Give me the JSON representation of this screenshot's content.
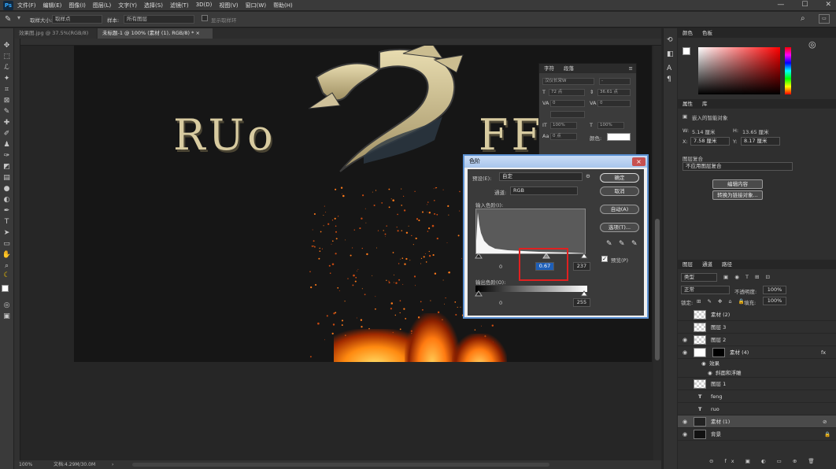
{
  "menu": {
    "items": [
      "文件(F)",
      "编辑(E)",
      "图像(I)",
      "图层(L)",
      "文字(Y)",
      "选择(S)",
      "滤镜(T)",
      "3D(D)",
      "视图(V)",
      "窗口(W)",
      "帮助(H)"
    ]
  },
  "options": {
    "size_label": "取样大小:",
    "size_value": "取样点",
    "sample_label": "样本:",
    "sample_value": "所有图层",
    "show_ring": "显示取样环"
  },
  "tabs": [
    {
      "label": "效果图.jpg @ 37.5%(RGB/8)",
      "close": "×"
    },
    {
      "label": "未标题-1 @ 100% (素材 (1), RGB/8) *",
      "close": "×"
    }
  ],
  "artwork": {
    "left_text": "RUo",
    "right_text": "FF"
  },
  "status": {
    "zoom": "100%",
    "doc": "文档:4.29M/30.0M"
  },
  "char_panel": {
    "tabs": [
      "字符",
      "段落"
    ],
    "font": "汉仪长宋W",
    "style": "-",
    "size": "72 点",
    "leading": "36.61 点",
    "kerning": "0",
    "tracking": "0",
    "vscale": "100%",
    "hscale": "100%",
    "baseline": "0 点",
    "color_label": "颜色:"
  },
  "levels": {
    "title": "色阶",
    "close": "×",
    "preset_label": "预设(E):",
    "preset_value": "自定",
    "channel_label": "通道:",
    "channel_value": "RGB",
    "input_label": "输入色阶(I):",
    "input_black": "0",
    "input_gamma": "0.67",
    "input_white": "237",
    "output_label": "输出色阶(O):",
    "output_black": "0",
    "output_white": "255",
    "ok": "确定",
    "cancel": "取消",
    "auto": "自动(A)",
    "options": "选项(T)...",
    "preview": "预览(P)"
  },
  "color_panel": {
    "tabs": [
      "色板",
      "色板"
    ],
    "title_tab": "颜色"
  },
  "properties": {
    "tabs": [
      "属性",
      "库"
    ],
    "heading": "嵌入的智能对象",
    "w_label": "W:",
    "w_value": "5.14 厘米",
    "h_label": "H:",
    "h_value": "13.65 厘米",
    "x_label": "X:",
    "x_value": "7.58 厘米",
    "y_label": "Y:",
    "y_value": "8.17 厘米",
    "comp_label": "图层复合",
    "comp_value": "不应用图层复合",
    "btn_edit": "编辑内容",
    "btn_convert": "转换为链接对象..."
  },
  "layers_panel": {
    "tabs": [
      "图层",
      "通道",
      "路径"
    ],
    "kind": "类型",
    "blend": "正常",
    "opacity_label": "不透明度:",
    "opacity_value": "100%",
    "lock_label": "锁定:",
    "fill_label": "填充:",
    "fill_value": "100%",
    "layers": [
      {
        "name": "素材 (2)",
        "visible": false,
        "type": "raster"
      },
      {
        "name": "图层 3",
        "visible": false,
        "type": "raster"
      },
      {
        "name": "图层 2",
        "visible": true,
        "type": "raster"
      },
      {
        "name": "素材 (4)",
        "visible": true,
        "type": "smart",
        "fx": "fx"
      },
      {
        "name": "效果",
        "visible": true,
        "type": "effect-group"
      },
      {
        "name": "斜面和浮雕",
        "visible": true,
        "type": "effect"
      },
      {
        "name": "图层 1",
        "visible": false,
        "type": "raster"
      },
      {
        "name": "feng",
        "visible": false,
        "type": "text"
      },
      {
        "name": "ruo",
        "visible": false,
        "type": "text"
      },
      {
        "name": "素材 (1)",
        "visible": true,
        "type": "smart",
        "selected": true
      },
      {
        "name": "背景",
        "visible": true,
        "type": "background"
      }
    ]
  },
  "colors": {
    "accent": "#31a8ff",
    "highlight_box": "#e02020",
    "gold_text": "#d8cba0"
  }
}
